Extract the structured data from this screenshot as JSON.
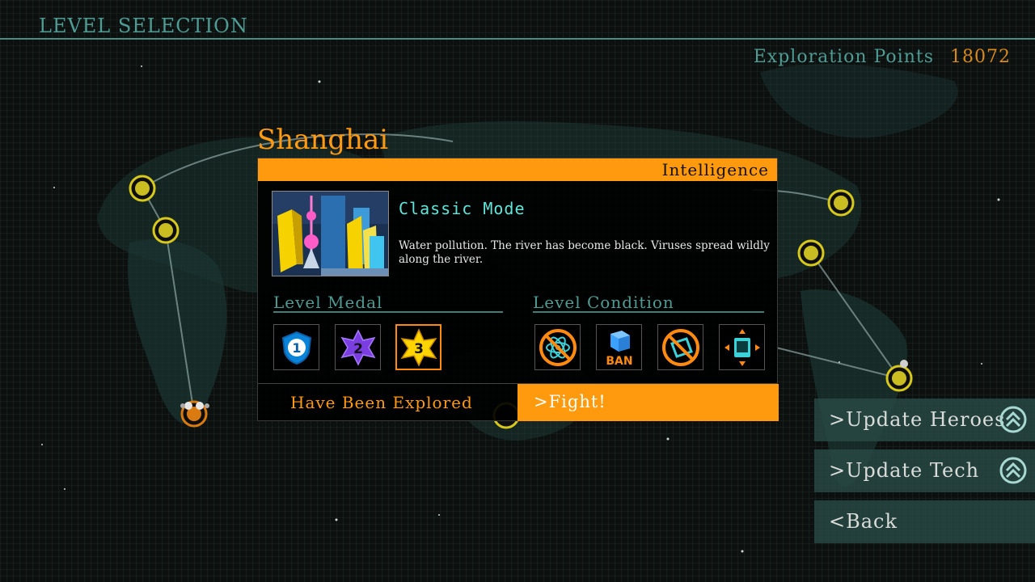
{
  "header": {
    "title": "LEVEL SELECTION"
  },
  "exploration": {
    "label": "Exploration Points",
    "value": "18072"
  },
  "level": {
    "city": "Shanghai",
    "category": "Intelligence",
    "mode": "Classic Mode",
    "description": "Water pollution. The river has become black. Viruses spread wildly along the river.",
    "medal_label": "Level Medal",
    "condition_label": "Level Condition",
    "medals": [
      {
        "icon": "shield-medal-1-icon",
        "number": "1"
      },
      {
        "icon": "star-medal-2-icon",
        "number": "2"
      },
      {
        "icon": "star-medal-3-icon",
        "number": "3",
        "selected": true
      }
    ],
    "conditions": [
      {
        "icon": "no-atom-icon"
      },
      {
        "icon": "ban-cube-icon",
        "text": "BAN"
      },
      {
        "icon": "no-device-icon"
      },
      {
        "icon": "screen-shrink-icon"
      }
    ],
    "explored_text": "Have Been Explored",
    "fight_label": ">Fight!"
  },
  "side_menu": {
    "update_heroes": ">Update Heroes",
    "update_tech": ">Update Tech",
    "back": "<Back"
  },
  "colors": {
    "accent": "#ff9a0e",
    "teal": "#4f9c94",
    "node": "#d7c81c"
  }
}
